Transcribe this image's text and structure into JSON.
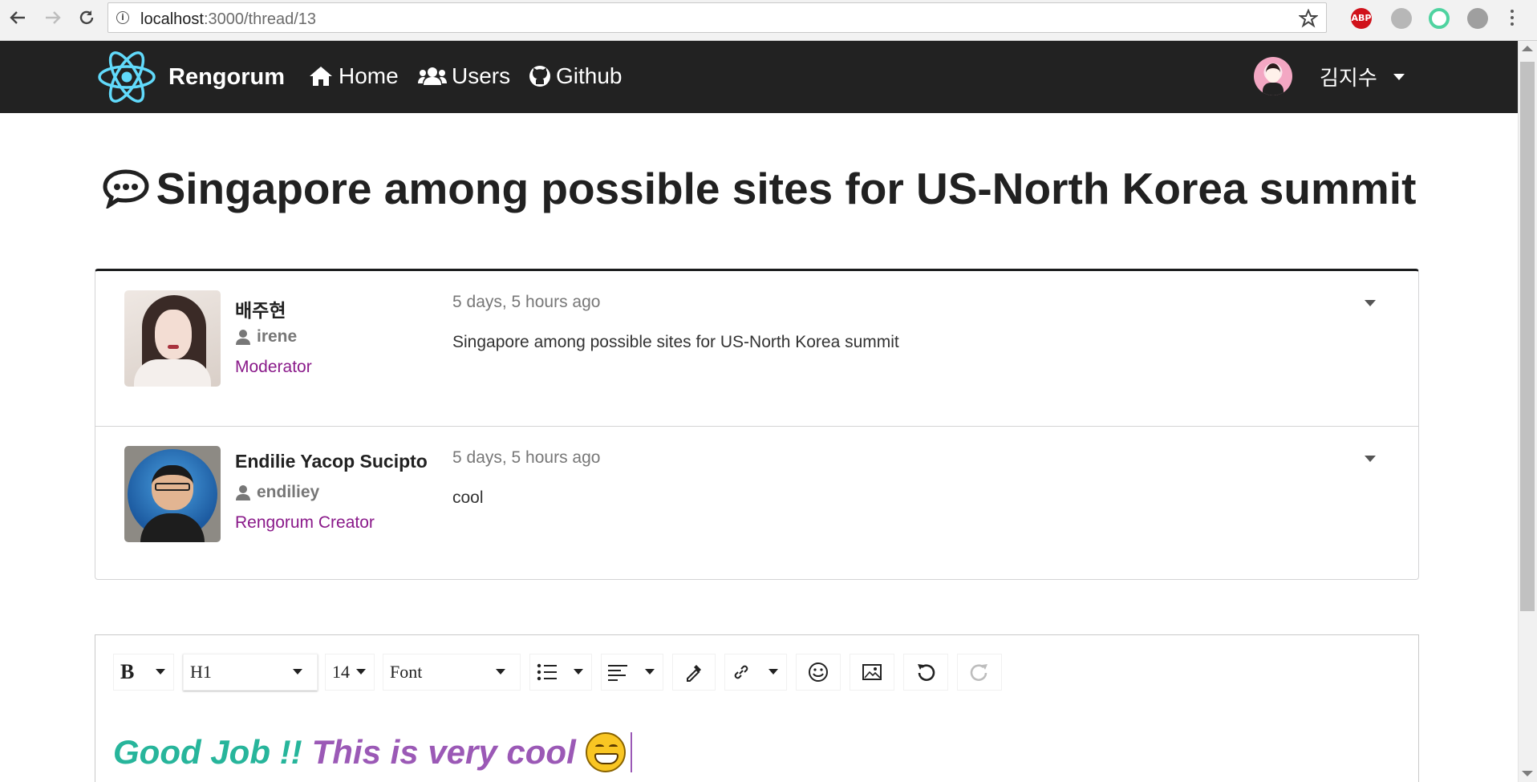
{
  "browser": {
    "url_host": "localhost",
    "url_path": ":3000/thread/13",
    "extension_abp": "ABP"
  },
  "nav": {
    "brand": "Rengorum",
    "items": [
      {
        "label": "Home",
        "icon": "home-icon"
      },
      {
        "label": "Users",
        "icon": "users-icon"
      },
      {
        "label": "Github",
        "icon": "github-icon"
      }
    ],
    "current_user": "김지수"
  },
  "thread": {
    "title": "Singapore among possible sites for US-North Korea summit",
    "posts": [
      {
        "name": "배주현",
        "username": "irene",
        "role": "Moderator",
        "time": "5 days, 5 hours ago",
        "content": "Singapore among possible sites for US-North Korea summit"
      },
      {
        "name": "Endilie Yacop Sucipto",
        "username": "endiliey",
        "role": "Rengorum Creator",
        "time": "5 days, 5 hours ago",
        "content": "cool"
      }
    ]
  },
  "editor": {
    "toolbar": {
      "bold": "B",
      "block_type": "H1",
      "font_size": "14",
      "font_family": "Font"
    },
    "text_part1": "Good Job !!",
    "text_part2": "This is very cool",
    "colors": {
      "green": "#27b59b",
      "purple": "#9b59b6"
    }
  }
}
